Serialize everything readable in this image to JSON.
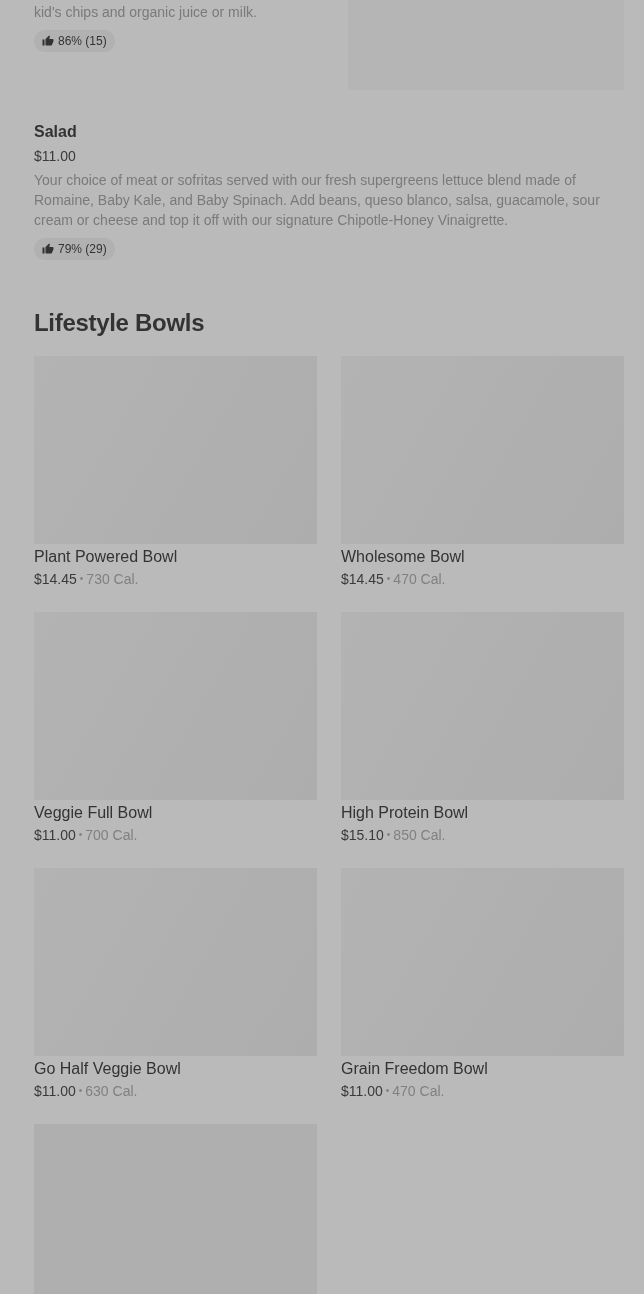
{
  "menu_items": [
    {
      "description": "kid's chips and organic juice or milk.",
      "rating": "86% (15)",
      "has_image": true
    },
    {
      "name": "Salad",
      "price": "$11.00",
      "description": "Your choice of meat or sofritas served with our fresh supergreens lettuce blend made of Romaine, Baby Kale, and Baby Spinach. Add beans, queso blanco, salsa, guacamole, sour cream or cheese and top it off with our signature Chipotle-Honey Vinaigrette.",
      "rating": "79% (29)",
      "has_image": false
    }
  ],
  "section": {
    "title": "Lifestyle Bowls",
    "products": [
      {
        "kind": "product",
        "name": "Plant Powered Bowl",
        "price": "$14.45",
        "separator": "•",
        "calories": "730 Cal."
      },
      {
        "kind": "product",
        "name": "Wholesome Bowl",
        "price": "$14.45",
        "separator": "•",
        "calories": "470 Cal."
      },
      {
        "kind": "product",
        "name": "Veggie Full Bowl",
        "price": "$11.00",
        "separator": "•",
        "calories": "700 Cal."
      },
      {
        "kind": "product",
        "name": "High Protein Bowl",
        "price": "$15.10",
        "separator": "•",
        "calories": "850 Cal."
      },
      {
        "kind": "product",
        "name": "Go Half Veggie Bowl",
        "price": "$11.00",
        "separator": "•",
        "calories": "630 Cal."
      },
      {
        "kind": "product",
        "name": "Grain Freedom Bowl",
        "price": "$11.00",
        "separator": "•",
        "calories": "470 Cal."
      },
      {
        "kind": "image_only"
      }
    ]
  }
}
